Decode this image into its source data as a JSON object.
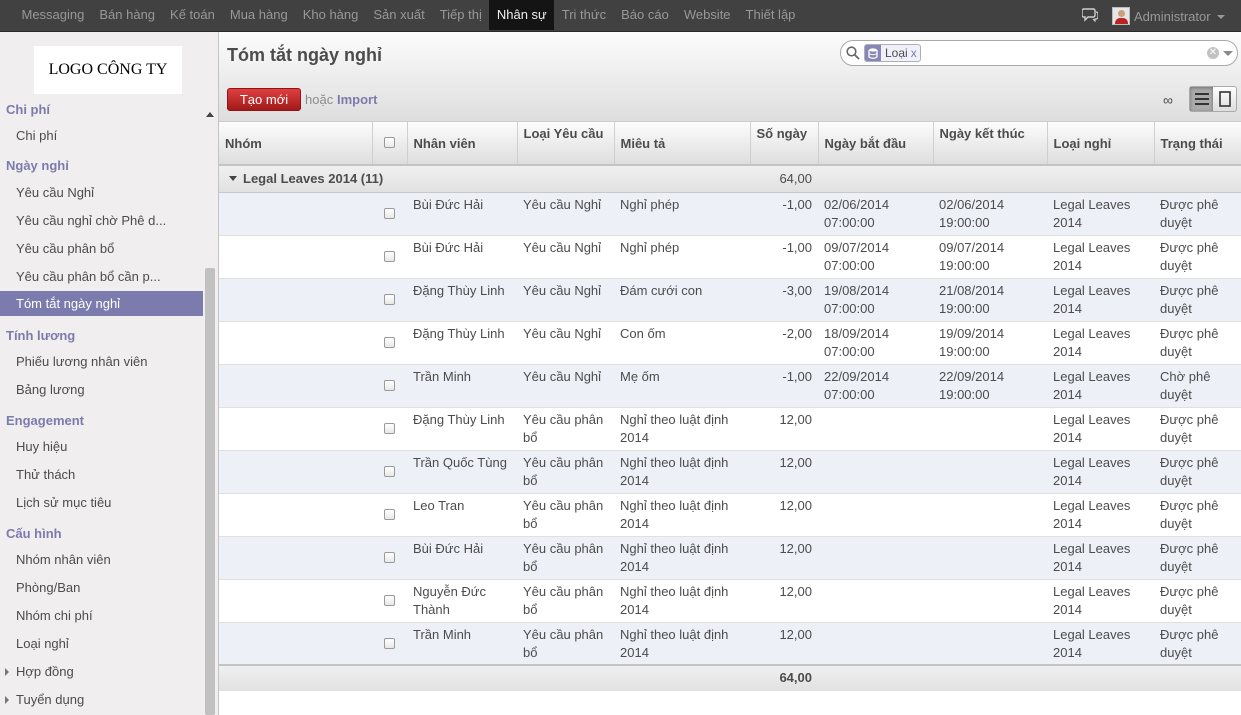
{
  "topbar": {
    "menu": [
      "Messaging",
      "Bán hàng",
      "Kế toán",
      "Mua hàng",
      "Kho hàng",
      "Sản xuất",
      "Tiếp thị",
      "Nhân sự",
      "Tri thức",
      "Báo cáo",
      "Website",
      "Thiết lập"
    ],
    "active_menu": "Nhân sự",
    "user_name": "Administrator"
  },
  "sidebar": {
    "logo_text": "LOGO CÔNG TY",
    "sections": {
      "chi_phi": "Chi phí",
      "ngay_nghi": "Ngày nghỉ",
      "tinh_luong": "Tính lương",
      "engagement": "Engagement",
      "cau_hinh": "Cấu hình"
    },
    "items": {
      "chi_phi": "Chi phí",
      "yeu_cau_nghi": "Yêu cầu Nghỉ",
      "yeu_cau_nghi_cho": "Yêu cầu nghỉ chờ Phê d...",
      "yeu_cau_phan_bo": "Yêu cầu phân bổ",
      "yeu_cau_phan_bo_can": "Yêu cầu phân bổ cần p...",
      "tom_tat": "Tóm tắt ngày nghỉ",
      "phieu_luong": "Phiếu lương nhân viên",
      "bang_luong": "Bảng lương",
      "huy_hieu": "Huy hiệu",
      "thu_thach": "Thử thách",
      "lich_su": "Lịch sử mục tiêu",
      "nhom_nv": "Nhóm nhân viên",
      "phong_ban": "Phòng/Ban",
      "nhom_chi_phi": "Nhóm chi phí",
      "loai_nghi": "Loại nghỉ",
      "hop_dong": "Hợp đồng",
      "tuyen_dung": "Tuyển dụng"
    }
  },
  "header": {
    "title": "Tóm tắt ngày nghỉ",
    "search_facet": "Loại",
    "facet_close": "x",
    "create_label": "Tạo mới",
    "or_label": "hoặc",
    "import_label": "Import",
    "infinity": "∞"
  },
  "table": {
    "columns": {
      "group": "Nhóm",
      "employee": "Nhân viên",
      "request_type": "Loại Yêu cầu",
      "description": "Miêu tả",
      "days": "Số ngày",
      "start": "Ngày bắt đầu",
      "end": "Ngày kết thúc",
      "leave_type": "Loại nghỉ",
      "status": "Trạng thái"
    },
    "group_row": {
      "label": "Legal Leaves 2014 (11)",
      "days": "64,00"
    },
    "rows": [
      {
        "employee": "Bùi Đức Hải",
        "request_type": "Yêu cầu Nghỉ",
        "description": "Nghỉ phép",
        "days": "-1,00",
        "start": "02/06/2014 07:00:00",
        "end": "02/06/2014 19:00:00",
        "leave_type": "Legal Leaves 2014",
        "status": "Được phê duyệt"
      },
      {
        "employee": "Bùi Đức Hải",
        "request_type": "Yêu cầu Nghỉ",
        "description": "Nghỉ phép",
        "days": "-1,00",
        "start": "09/07/2014 07:00:00",
        "end": "09/07/2014 19:00:00",
        "leave_type": "Legal Leaves 2014",
        "status": "Được phê duyệt"
      },
      {
        "employee": "Đặng Thùy Linh",
        "request_type": "Yêu cầu Nghỉ",
        "description": "Đám cưới con",
        "days": "-3,00",
        "start": "19/08/2014 07:00:00",
        "end": "21/08/2014 19:00:00",
        "leave_type": "Legal Leaves 2014",
        "status": "Được phê duyệt"
      },
      {
        "employee": "Đặng Thùy Linh",
        "request_type": "Yêu cầu Nghỉ",
        "description": "Con ốm",
        "days": "-2,00",
        "start": "18/09/2014 07:00:00",
        "end": "19/09/2014 19:00:00",
        "leave_type": "Legal Leaves 2014",
        "status": "Được phê duyệt"
      },
      {
        "employee": "Trần Minh",
        "request_type": "Yêu cầu Nghỉ",
        "description": "Mẹ ốm",
        "days": "-1,00",
        "start": "22/09/2014 07:00:00",
        "end": "22/09/2014 19:00:00",
        "leave_type": "Legal Leaves 2014",
        "status": "Chờ phê duyệt"
      },
      {
        "employee": "Đặng Thùy Linh",
        "request_type": "Yêu cầu phân bổ",
        "description": "Nghỉ theo luật định 2014",
        "days": "12,00",
        "start": "",
        "end": "",
        "leave_type": "Legal Leaves 2014",
        "status": "Được phê duyệt"
      },
      {
        "employee": "Trần Quốc Tùng",
        "request_type": "Yêu cầu phân bổ",
        "description": "Nghỉ theo luật định 2014",
        "days": "12,00",
        "start": "",
        "end": "",
        "leave_type": "Legal Leaves 2014",
        "status": "Được phê duyệt"
      },
      {
        "employee": "Leo Tran",
        "request_type": "Yêu cầu phân bổ",
        "description": "Nghỉ theo luật định 2014",
        "days": "12,00",
        "start": "",
        "end": "",
        "leave_type": "Legal Leaves 2014",
        "status": "Được phê duyệt"
      },
      {
        "employee": "Bùi Đức Hải",
        "request_type": "Yêu cầu phân bổ",
        "description": "Nghỉ theo luật định 2014",
        "days": "12,00",
        "start": "",
        "end": "",
        "leave_type": "Legal Leaves 2014",
        "status": "Được phê duyệt"
      },
      {
        "employee": "Nguyễn Đức Thành",
        "request_type": "Yêu cầu phân bổ",
        "description": "Nghỉ theo luật định 2014",
        "days": "12,00",
        "start": "",
        "end": "",
        "leave_type": "Legal Leaves 2014",
        "status": "Được phê duyệt"
      },
      {
        "employee": "Trần Minh",
        "request_type": "Yêu cầu phân bổ",
        "description": "Nghỉ theo luật định 2014",
        "days": "12,00",
        "start": "",
        "end": "",
        "leave_type": "Legal Leaves 2014",
        "status": "Được phê duyệt"
      }
    ],
    "total_days": "64,00"
  }
}
